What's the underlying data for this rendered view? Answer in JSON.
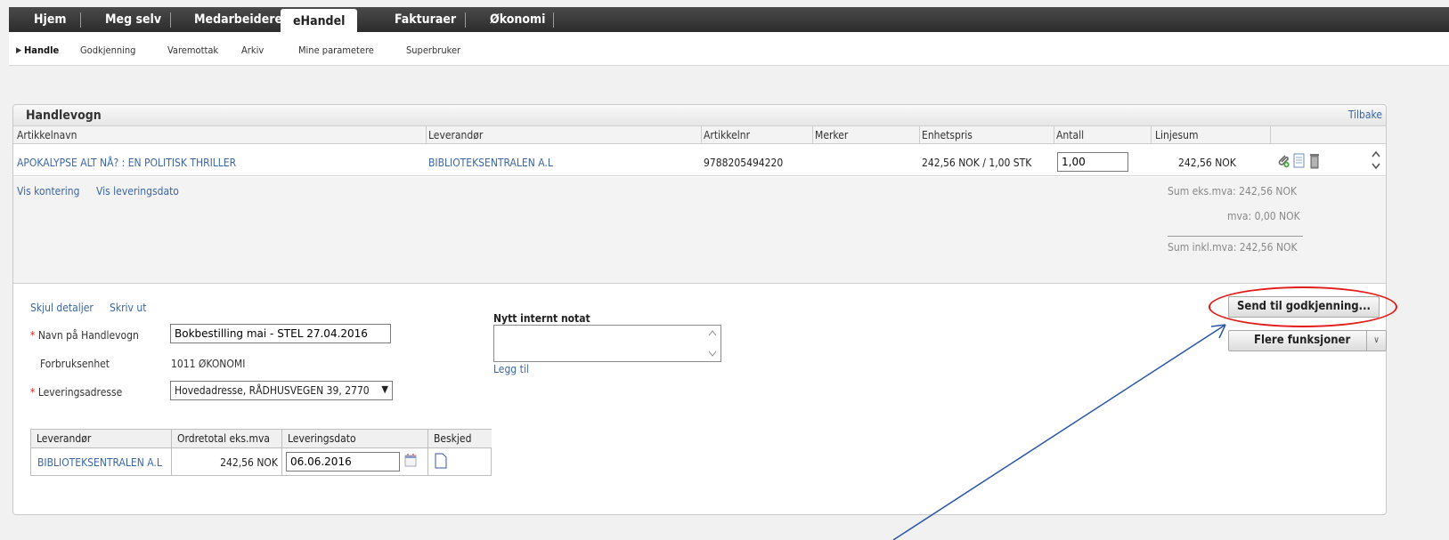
{
  "topnav": {
    "tabs": [
      "Hjem",
      "Meg selv",
      "Medarbeidere",
      "eHandel",
      "Fakturaer",
      "Økonomi"
    ],
    "active": "eHandel"
  },
  "subnav": {
    "items": [
      "Handle",
      "Godkjenning",
      "Varemottak",
      "Arkiv",
      "Mine parametere",
      "Superbruker"
    ],
    "active": "Handle"
  },
  "cart": {
    "title": "Handlevogn",
    "back_label": "Tilbake",
    "columns": [
      "Artikkelnavn",
      "Leverandør",
      "Artikkelnr",
      "Merker",
      "Enhetspris",
      "Antall",
      "Linjesum"
    ],
    "item": {
      "name": "APOKALYPSE ALT NÅ? : EN POLITISK THRILLER",
      "supplier": "BIBLIOTEKSENTRALEN A.L",
      "article_no": "9788205494220",
      "unit_price": "242,56 NOK / 1,00 STK",
      "quantity": "1,00",
      "line_sum": "242,56 NOK"
    },
    "links": {
      "vis_kontering": "Vis kontering",
      "vis_leveringsdato": "Vis leveringsdato"
    },
    "summary": {
      "sum_ex": "Sum eks.mva: 242,56 NOK",
      "mva": "mva: 0,00 NOK",
      "sum_inkl": "Sum inkl.mva: 242,56 NOK"
    }
  },
  "details": {
    "hide_label": "Skjul detaljer",
    "print_label": "Skriv ut",
    "name_label": "Navn på Handlevogn",
    "name_value": "Bokbestilling mai - STEL 27.04.2016",
    "unit_label": "Forbruksenhet",
    "unit_value": "1011 ØKONOMI",
    "address_label": "Leveringsadresse",
    "address_value": "Hovedadresse, RÅDHUSVEGEN 39, 2770"
  },
  "note": {
    "title": "Nytt internt notat",
    "add_label": "Legg til"
  },
  "supplier_table": {
    "headers": [
      "Leverandør",
      "Ordretotal eks.mva",
      "Leveringsdato",
      "Beskjed"
    ],
    "row": {
      "supplier": "BIBLIOTEKSENTRALEN A.L",
      "total": "242,56 NOK",
      "date": "06.06.2016"
    }
  },
  "actions": {
    "send_label": "Send til godkjenning...",
    "more_label": "Flere funksjoner"
  },
  "colors": {
    "link": "#3a66a7",
    "annotation_circle": "#e21b1b",
    "annotation_arrow": "#2a56a8"
  }
}
